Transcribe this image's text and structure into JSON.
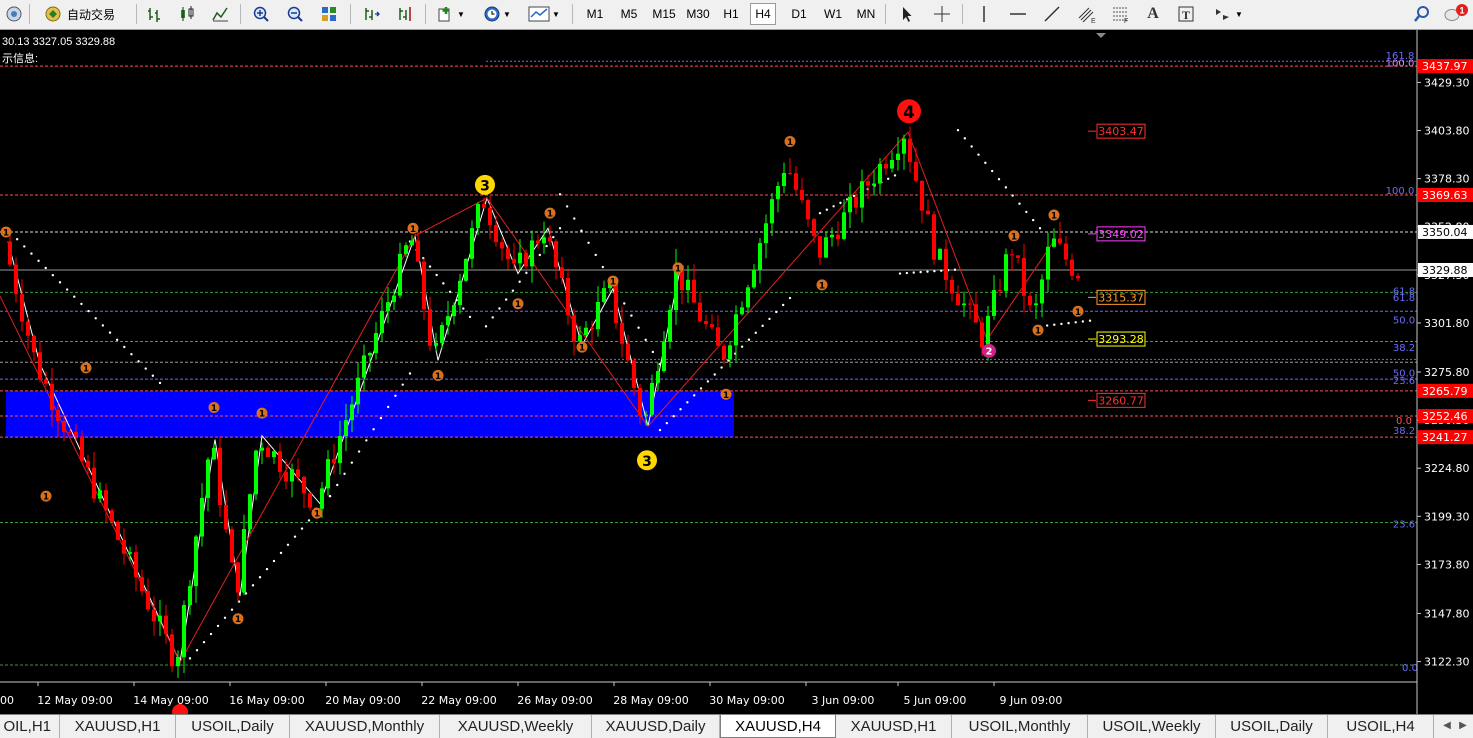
{
  "toolbar": {
    "autotrade_label": "自动交易",
    "timeframes": [
      "M1",
      "M5",
      "M15",
      "M30",
      "H1",
      "H4",
      "D1",
      "W1",
      "MN"
    ],
    "active_timeframe": "H4",
    "notification_count": "1"
  },
  "chart_info": {
    "ohlc_line": "30.13 3327.05 3329.88",
    "tip_line": "示信息:"
  },
  "chart_data": {
    "type": "candlestick",
    "symbol": "XAUUSD",
    "timeframe": "H4",
    "y_ticks": [
      "3429.30",
      "3403.80",
      "3378.30",
      "3352.80",
      "3327.30",
      "3301.80",
      "3275.80",
      "3250.30",
      "3224.80",
      "3199.30",
      "3173.80",
      "3147.80",
      "3122.30"
    ],
    "x_ticks": [
      "12 May 09:00",
      "14 May 09:00",
      "16 May 09:00",
      "20 May 09:00",
      "22 May 09:00",
      "26 May 09:00",
      "28 May 09:00",
      "30 May 09:00",
      "3 Jun 09:00",
      "5 Jun 09:00",
      "9 Jun 09:00"
    ],
    "x_tick_partial": "00",
    "current_price": "3329.88",
    "price_tags": [
      {
        "label": "3437.97",
        "color": "#ff0000"
      },
      {
        "label": "3369.63",
        "color": "#ff0000"
      },
      {
        "label": "3350.04",
        "color": "#ffffff"
      },
      {
        "label": "3329.88",
        "color": "#ffffff"
      },
      {
        "label": "3265.79",
        "color": "#ff0000"
      },
      {
        "label": "3252.46",
        "color": "#ff0000"
      },
      {
        "label": "3241.27",
        "color": "#ff0000"
      }
    ],
    "level_boxes": [
      {
        "label": "3403.47",
        "color": "#ff3030"
      },
      {
        "label": "3349.02",
        "color": "#ff3cff"
      },
      {
        "label": "3315.37",
        "color": "#ff9a30"
      },
      {
        "label": "3293.28",
        "color": "#ffff00"
      },
      {
        "label": "3260.77",
        "color": "#ff3030"
      }
    ],
    "fib_labels": [
      "161.8",
      "100.0",
      "100.0",
      "61.8",
      "61.8",
      "50.0",
      "38.2",
      "50.0",
      "23.6",
      "0.0",
      "38.2",
      "23.6",
      "0.0"
    ],
    "wave_labels": [
      "3",
      "3",
      "4",
      "2"
    ],
    "minor_wave_label": "1",
    "zone": {
      "low": 3241.27,
      "high": 3265.79,
      "color": "#0000ff"
    },
    "colors": {
      "up": "#00ff00",
      "down": "#ff0000",
      "background": "#000000"
    }
  },
  "tabs": [
    "OIL,H1",
    "XAUUSD,H1",
    "USOIL,Daily",
    "XAUUSD,Monthly",
    "XAUUSD,Weekly",
    "XAUUSD,Daily",
    "XAUUSD,H4",
    "XAUUSD,H1",
    "USOIL,Monthly",
    "USOIL,Weekly",
    "USOIL,Daily",
    "USOIL,H4"
  ],
  "active_tab": 6
}
